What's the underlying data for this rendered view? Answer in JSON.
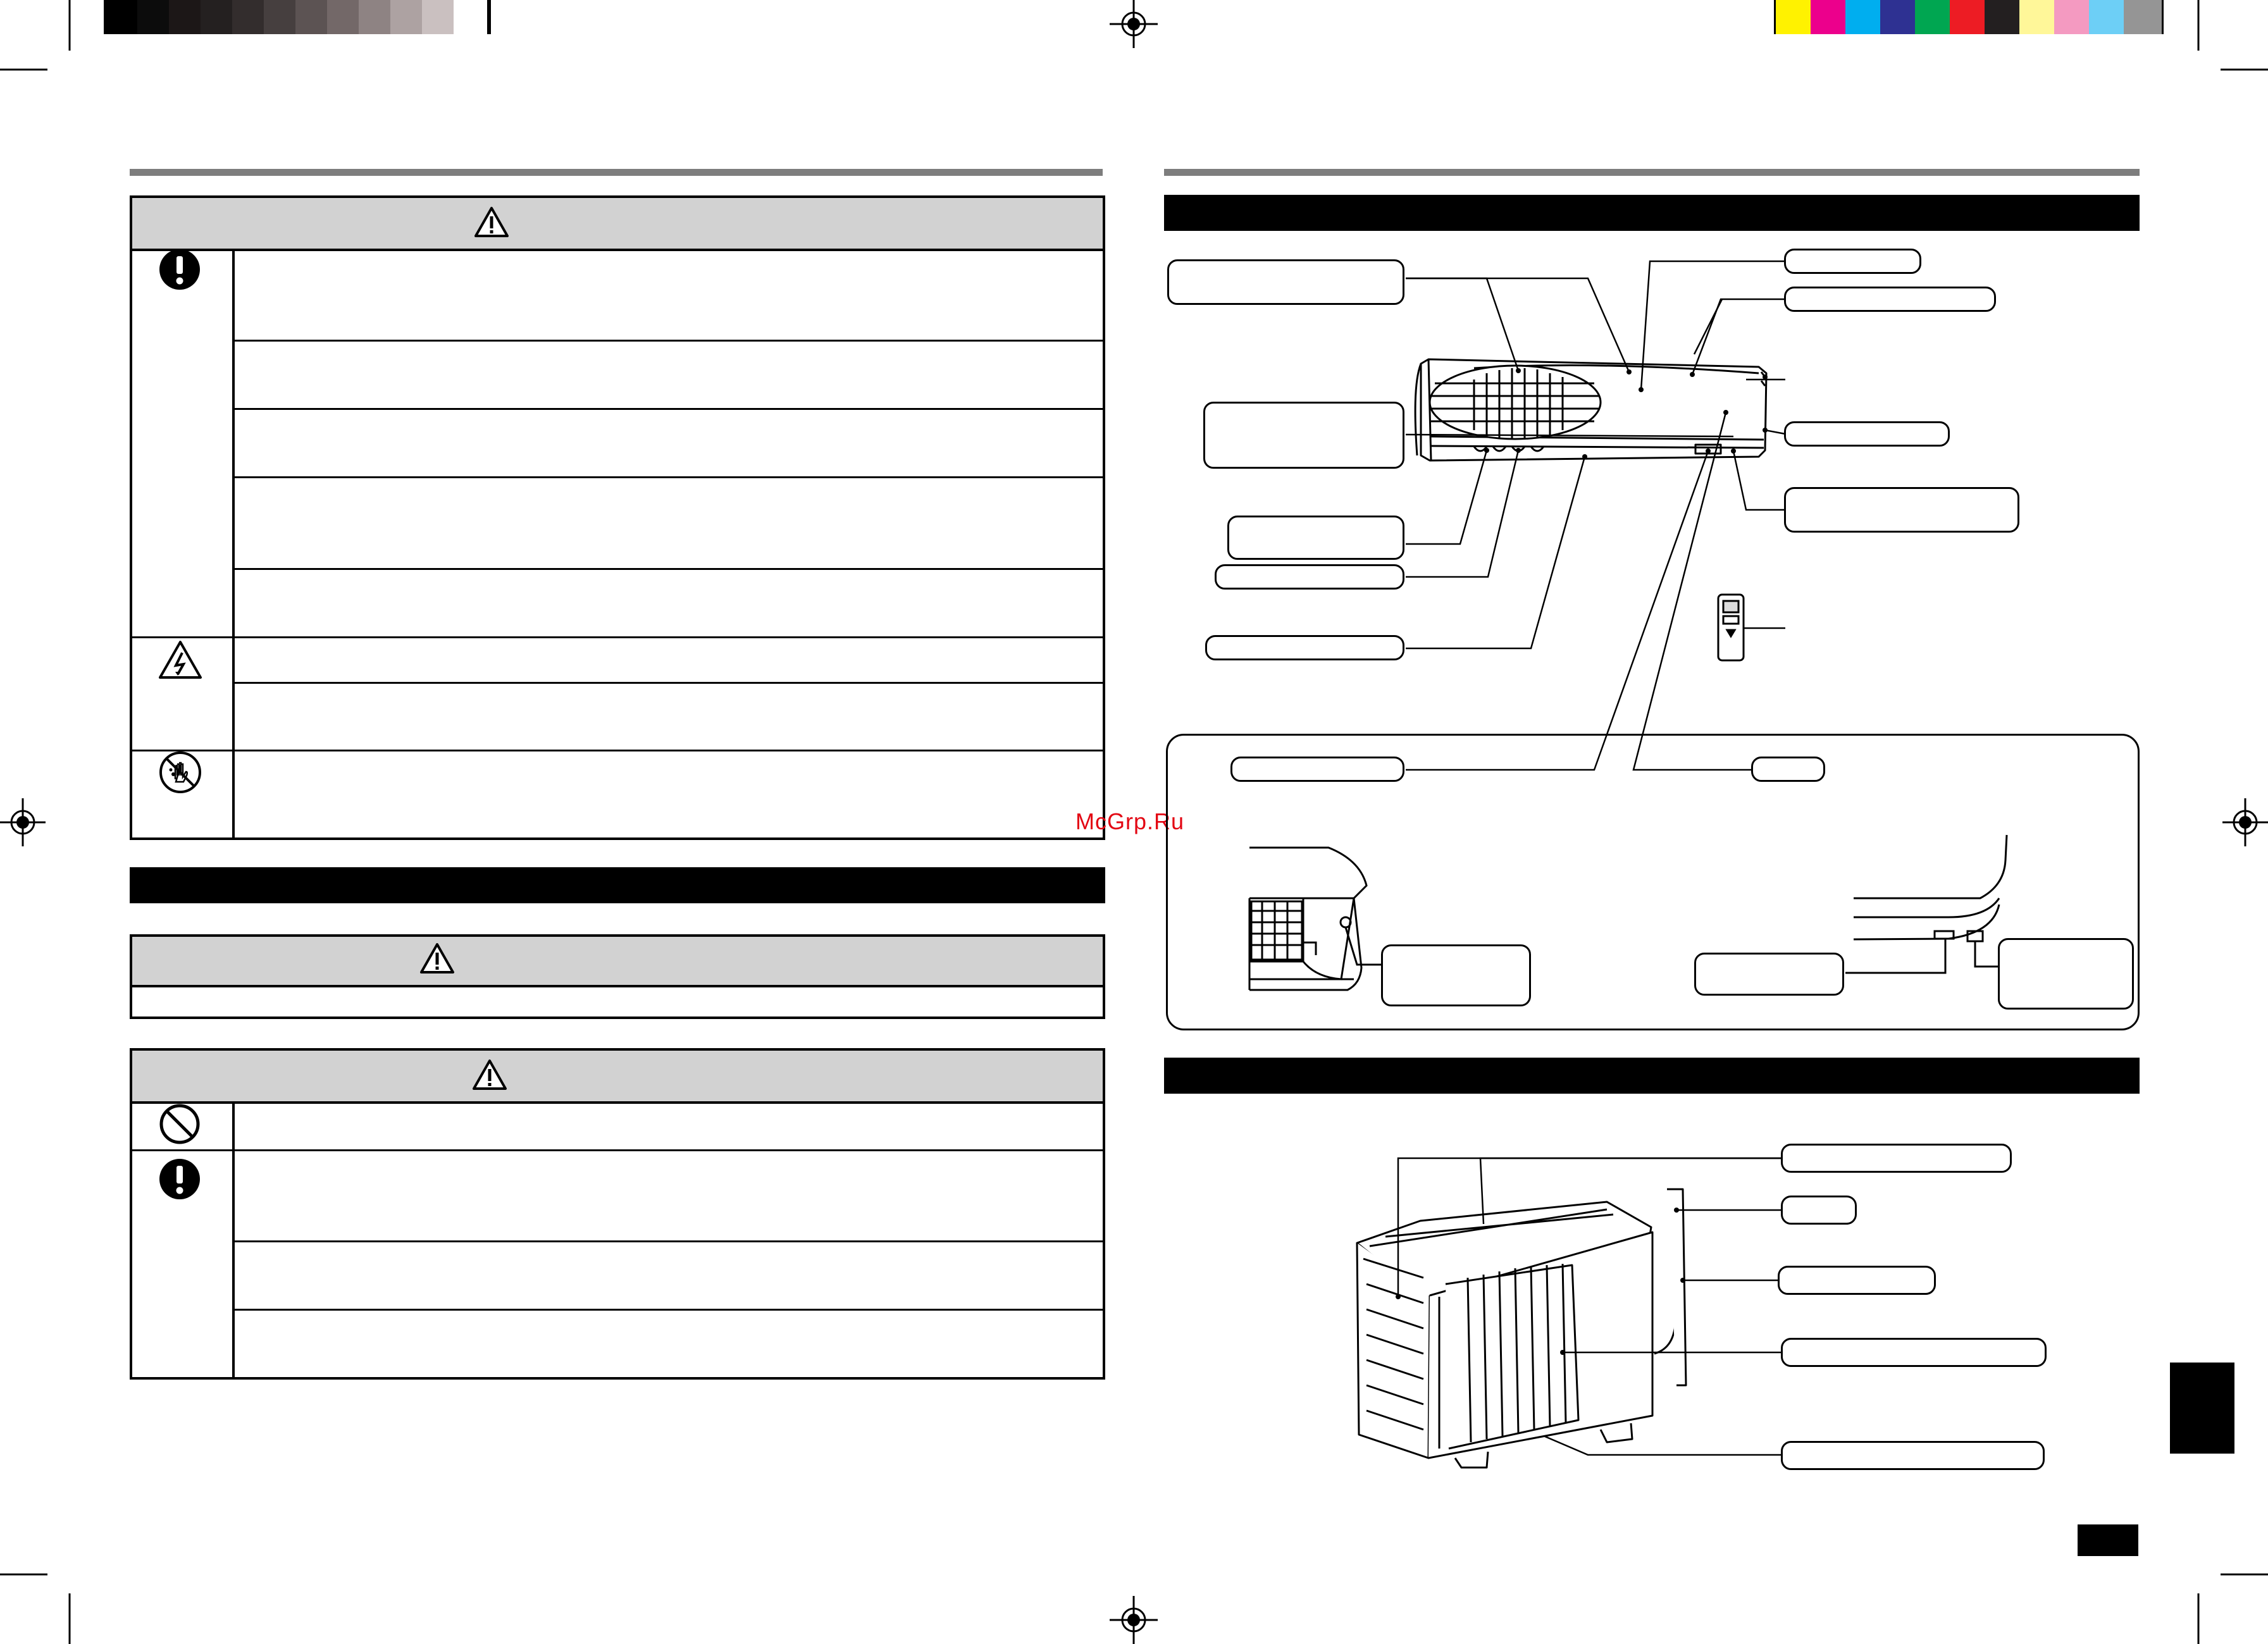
{
  "watermark": {
    "text": "McGrp.Ru"
  },
  "colors": {
    "grey_swatches": [
      "#000000",
      "#0c0c0c",
      "#1c1717",
      "#242020",
      "#332d2d",
      "#463f3f",
      "#5c5353",
      "#736868",
      "#8e8383",
      "#ada2a2",
      "#cac0c0",
      "#ffffff"
    ],
    "process_swatches": [
      "#fff200",
      "#ec008c",
      "#00aeef",
      "#2e3192",
      "#00a651",
      "#ed1c24",
      "#231f20",
      "#fff799",
      "#f49ac1",
      "#6dcff6",
      "#959595"
    ],
    "header_grey": "#d2d2d2",
    "rule_grey": "#7d7d7d"
  },
  "icons": {
    "warning_headers": "warning-triangle-icon",
    "mandatory": "exclamation-icon",
    "electric": "electric-shock-icon",
    "no_water": "no-wet-hands-icon",
    "prohibited": "prohibition-icon",
    "registration": "registration-crosshair-icon"
  }
}
